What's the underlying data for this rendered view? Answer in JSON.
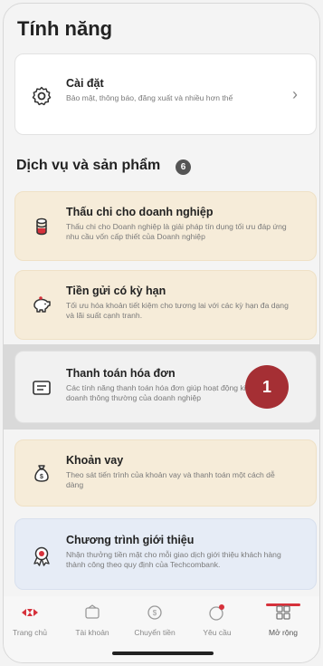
{
  "header": {
    "title": "Tính năng"
  },
  "settings_card": {
    "title": "Cài đặt",
    "description": "Bảo mật, thông báo, đăng xuất và nhiều hơn thế",
    "icon": "gear-icon",
    "chevron": "›"
  },
  "services": {
    "section_title": "Dịch vụ và sản phẩm",
    "count": "6",
    "items": [
      {
        "title": "Thấu chi cho doanh nghiệp",
        "description": "Thấu chi cho Doanh nghiệp là giải pháp tín dụng tối ưu đáp ứng nhu cầu vốn cấp thiết của Doanh nghiệp",
        "icon": "coin-stack-icon"
      },
      {
        "title": "Tiền gửi có kỳ hạn",
        "description": "Tối ưu hóa khoản tiết kiệm cho tương lai với các kỳ hạn đa dạng và lãi suất cạnh tranh.",
        "icon": "piggy-bank-icon"
      },
      {
        "title": "Thanh toán hóa đơn",
        "description": "Các tính năng thanh toán hóa đơn giúp hoạt động kinh doanh thông thường của doanh nghiệp",
        "icon": "bill-icon"
      },
      {
        "title": "Khoản vay",
        "description": "Theo sát tiến trình của khoản vay và thanh toán một cách dễ dàng",
        "icon": "money-bag-icon"
      },
      {
        "title": "Chương trình giới thiệu",
        "description": "Nhận thưởng tiền mặt cho mỗi giao dịch giới thiệu khách hàng thành công theo quy định của Techcombank.",
        "icon": "award-icon"
      }
    ]
  },
  "annotation_marker": "1",
  "bottom_nav": [
    {
      "label": "Trang chủ",
      "icon": "home-logo-icon"
    },
    {
      "label": "Tài khoản",
      "icon": "wallet-icon"
    },
    {
      "label": "Chuyển tiền",
      "icon": "transfer-icon"
    },
    {
      "label": "Yêu cầu",
      "icon": "request-icon"
    },
    {
      "label": "Mở rộng",
      "icon": "grid-icon",
      "active": true
    }
  ],
  "colors": {
    "accent": "#d6313b",
    "marker": "#a52f34",
    "beige_card": "#f6ecd9",
    "blue_card": "#e6ecf6"
  }
}
